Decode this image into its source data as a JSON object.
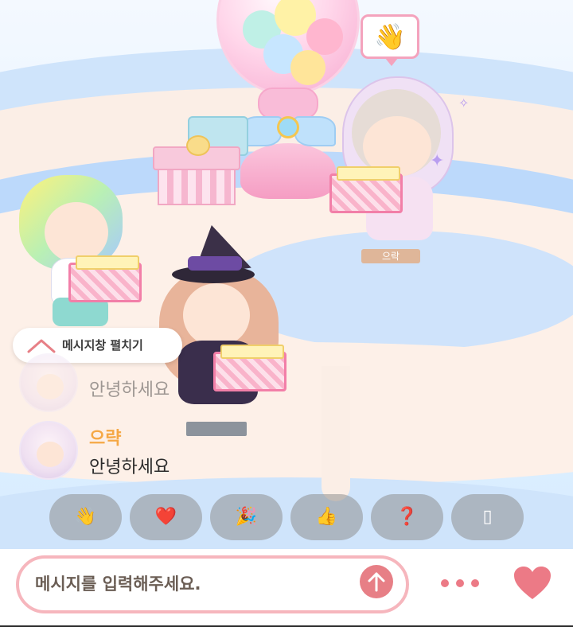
{
  "scene": {
    "player_name_tag": "으락"
  },
  "emote_bubble": {
    "icon": "waving-hand-icon",
    "glyph": "👋"
  },
  "chat": {
    "expand_label": "메시지창 펼치기",
    "messages": [
      {
        "nickname": "",
        "text": "안녕하세요",
        "faded": true
      },
      {
        "nickname": "으략",
        "text": "안녕하세요",
        "faded": false
      }
    ]
  },
  "emote_buttons": [
    {
      "icon": "waving-hand-icon",
      "glyph": "👋"
    },
    {
      "icon": "heart-icon",
      "glyph": "❤️"
    },
    {
      "icon": "party-popper-icon",
      "glyph": "🎉"
    },
    {
      "icon": "thumbs-up-icon",
      "glyph": "👍"
    },
    {
      "icon": "question-icon",
      "glyph": "❓"
    },
    {
      "icon": "unknown-icon",
      "glyph": "▯"
    }
  ],
  "input": {
    "placeholder": "메시지를 입력해주세요."
  },
  "colors": {
    "nickname": "#f5a845",
    "input_border": "#f6b6bd",
    "send_button": "#e77f86",
    "heart": "#ec7a86"
  }
}
